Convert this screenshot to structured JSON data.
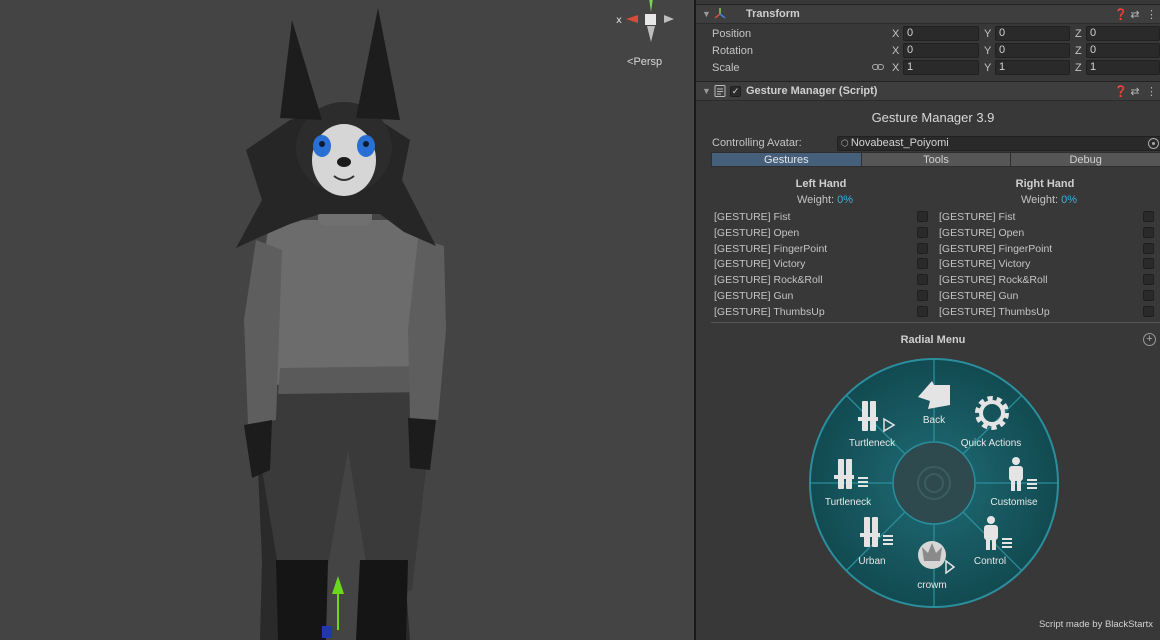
{
  "scene": {
    "projection_label": "Persp"
  },
  "transform": {
    "title": "Transform",
    "position": {
      "label": "Position",
      "x": "0",
      "y": "0",
      "z": "0"
    },
    "rotation": {
      "label": "Rotation",
      "x": "0",
      "y": "0",
      "z": "0"
    },
    "scale": {
      "label": "Scale",
      "x": "1",
      "y": "1",
      "z": "1"
    },
    "axis": {
      "x": "X",
      "y": "Y",
      "z": "Z"
    }
  },
  "gesture_manager": {
    "header_title": "Gesture Manager (Script)",
    "title": "Gesture Manager 3.9",
    "controlling_label": "Controlling Avatar:",
    "controlling_value": "Novabeast_Poiyomi",
    "tabs": [
      "Gestures",
      "Tools",
      "Debug"
    ],
    "active_tab": "Gestures",
    "left_hand": {
      "title": "Left Hand",
      "weight_label": "Weight:",
      "weight_value": "0%",
      "gestures": [
        "[GESTURE] Fist",
        "[GESTURE] Open",
        "[GESTURE] FingerPoint",
        "[GESTURE] Victory",
        "[GESTURE] Rock&Roll",
        "[GESTURE] Gun",
        "[GESTURE] ThumbsUp"
      ]
    },
    "right_hand": {
      "title": "Right Hand",
      "weight_label": "Weight:",
      "weight_value": "0%",
      "gestures": [
        "[GESTURE] Fist",
        "[GESTURE] Open",
        "[GESTURE] FingerPoint",
        "[GESTURE] Victory",
        "[GESTURE] Rock&Roll",
        "[GESTURE] Gun",
        "[GESTURE] ThumbsUp"
      ]
    },
    "radial_menu": {
      "title": "Radial Menu",
      "items": [
        {
          "label": "Back",
          "icon": "back-icon"
        },
        {
          "label": "Quick Actions",
          "icon": "gear-icon"
        },
        {
          "label": "Customise",
          "icon": "person-submenu-icon"
        },
        {
          "label": "Control",
          "icon": "person-submenu-icon"
        },
        {
          "label": "crowm",
          "icon": "crown-play-icon"
        },
        {
          "label": "Urban",
          "icon": "shirt-submenu-icon"
        },
        {
          "label": "Turtleneck",
          "icon": "shirt-submenu-icon"
        },
        {
          "label": "Turtleneck",
          "icon": "shirt-play-icon"
        }
      ]
    },
    "credit": "Script made by BlackStartx"
  },
  "colors": {
    "accent": "#3ab0d6",
    "radial_fill": "#15565e",
    "radial_ring": "#2b8e9c",
    "active_tab": "#46607c"
  }
}
